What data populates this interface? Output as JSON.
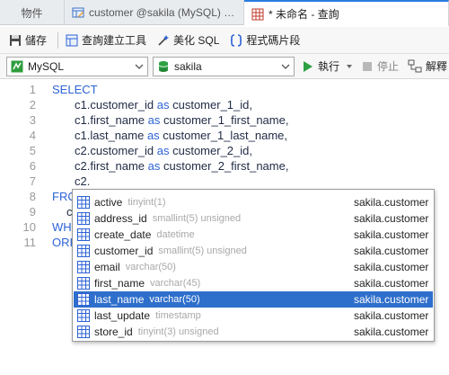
{
  "tabs": [
    {
      "label": "物件",
      "icon": "none"
    },
    {
      "label": "customer @sakila (MySQL) - ...",
      "icon": "table-edit-icon"
    },
    {
      "label": "* 未命名 - 查詢",
      "icon": "query-grid-icon",
      "active": true
    }
  ],
  "toolbar": {
    "save_label": "儲存",
    "query_builder_label": "查詢建立工具",
    "beautify_label": "美化 SQL",
    "snippet_label": "程式碼片段"
  },
  "connection": {
    "server_value": "MySQL",
    "database_value": "sakila",
    "run_label": "執行",
    "stop_label": "停止",
    "explain_label": "解釋"
  },
  "editor": {
    "line_numbers": [
      "1",
      "2",
      "3",
      "4",
      "5",
      "6",
      "7",
      "8",
      "9",
      "10",
      "11"
    ],
    "lines": {
      "l1": {
        "kw": "SELECT"
      },
      "l2": {
        "a": "c1.customer_id ",
        "kw": "as",
        "b": " customer_1_id,"
      },
      "l3": {
        "a": "c1.first_name ",
        "kw": "as",
        "b": " customer_1_first_name,"
      },
      "l4": {
        "a": "c1.last_name ",
        "kw": "as",
        "b": " customer_1_last_name,"
      },
      "l5": {
        "a": "c2.customer_id ",
        "kw": "as",
        "b": " customer_2_id,"
      },
      "l6": {
        "a": "c2.first_name ",
        "kw": "as",
        "b": " customer_2_first_name,"
      },
      "l7": {
        "a": "c2."
      },
      "l8": {
        "kw": "FRO"
      },
      "l9": {
        "a": "c"
      },
      "l10": {
        "kw": "WH"
      },
      "l11": {
        "kw": "ORI"
      }
    }
  },
  "autocomplete": {
    "items": [
      {
        "name": "active",
        "type": "tinyint(1)",
        "source": "sakila.customer"
      },
      {
        "name": "address_id",
        "type": "smallint(5) unsigned",
        "source": "sakila.customer"
      },
      {
        "name": "create_date",
        "type": "datetime",
        "source": "sakila.customer"
      },
      {
        "name": "customer_id",
        "type": "smallint(5) unsigned",
        "source": "sakila.customer"
      },
      {
        "name": "email",
        "type": "varchar(50)",
        "source": "sakila.customer"
      },
      {
        "name": "first_name",
        "type": "varchar(45)",
        "source": "sakila.customer"
      },
      {
        "name": "last_name",
        "type": "varchar(50)",
        "source": "sakila.customer",
        "selected": true
      },
      {
        "name": "last_update",
        "type": "timestamp",
        "source": "sakila.customer"
      },
      {
        "name": "store_id",
        "type": "tinyint(3) unsigned",
        "source": "sakila.customer"
      }
    ]
  },
  "colors": {
    "keyword": "#2d63d6",
    "selection": "#2f6fcc",
    "run_green": "#2ea043",
    "tab_accent": "#2a7de1"
  }
}
